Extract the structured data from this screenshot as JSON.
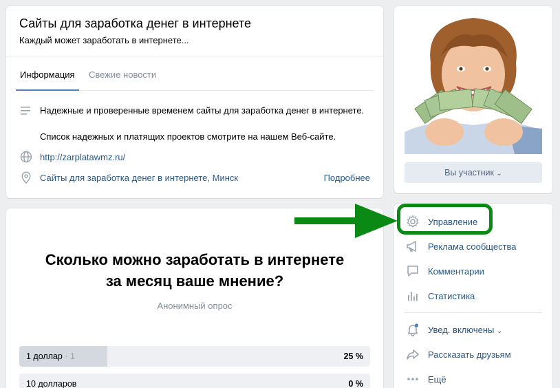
{
  "header": {
    "title": "Сайты для заработка денег в интернете",
    "subtitle": "Каждый может заработать в интернете..."
  },
  "tabs": [
    {
      "label": "Информация",
      "active": true
    },
    {
      "label": "Свежие новости",
      "active": false
    }
  ],
  "info": {
    "description_1": "Надежные и проверенные временем сайты для заработка денег в интернете.",
    "description_2": "Список надежных и платящих проектов смотрите на нашем Веб-сайте.",
    "website": "http://zarplatawmz.ru/",
    "location": "Сайты для заработка денег в интернете, Минск",
    "more_label": "Подробнее"
  },
  "poll": {
    "question_line1": "Сколько можно заработать в интернете",
    "question_line2": "за месяц ваше мнение?",
    "type_label": "Анонимный опрос",
    "options": [
      {
        "label": "1 доллар",
        "count": "· 1",
        "percent_text": "25 %",
        "fraction": 0.25
      },
      {
        "label": "10 долларов",
        "count": "",
        "percent_text": "0 %",
        "fraction": 0
      }
    ]
  },
  "sidebar": {
    "member_button": "Вы участник",
    "menu": [
      {
        "label": "Управление",
        "icon": "gear-icon"
      },
      {
        "label": "Реклама сообщества",
        "icon": "megaphone-icon"
      },
      {
        "label": "Комментарии",
        "icon": "comment-icon"
      },
      {
        "label": "Статистика",
        "icon": "stats-icon"
      },
      {
        "label": "Увед. включены",
        "icon": "bell-icon"
      },
      {
        "label": "Рассказать друзьям",
        "icon": "share-icon"
      },
      {
        "label": "Ещё",
        "icon": "more-icon"
      }
    ]
  },
  "colors": {
    "accent": "#5181b8",
    "link": "#2a5885",
    "highlight": "#0a8a14"
  }
}
